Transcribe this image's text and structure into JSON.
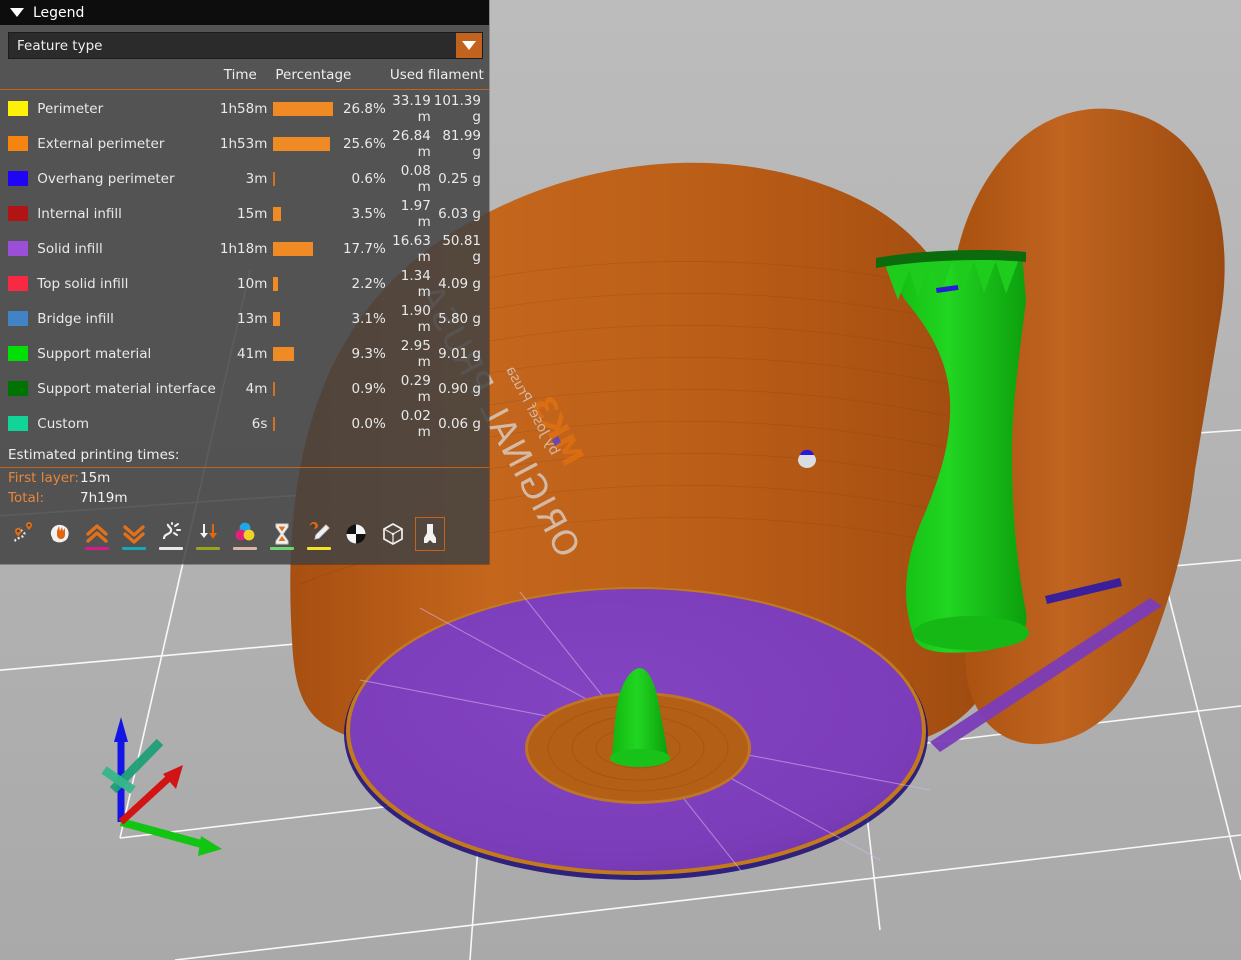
{
  "window": {
    "background_color": "#b4b4b4",
    "viewport_name": "gcode-preview-3d-viewport"
  },
  "legend": {
    "title": "Legend",
    "collapse_icon": "triangle-down-icon",
    "view_type": {
      "selected": "Feature type",
      "dropdown_icon": "chevron-down-icon"
    },
    "columns": {
      "feature": "",
      "time": "Time",
      "percentage": "Percentage",
      "used_filament": "Used filament"
    },
    "rows": [
      {
        "color": "#fcf107",
        "name": "Perimeter",
        "time": "1h58m",
        "percentage": "26.8%",
        "pct_value": 26.8,
        "length": "33.19 m",
        "weight": "101.39 g"
      },
      {
        "color": "#f58410",
        "name": "External perimeter",
        "time": "1h53m",
        "percentage": "25.6%",
        "pct_value": 25.6,
        "length": "26.84 m",
        "weight": "81.99 g"
      },
      {
        "color": "#1f04f5",
        "name": "Overhang perimeter",
        "time": "3m",
        "percentage": "0.6%",
        "pct_value": 0.6,
        "length": "0.08 m",
        "weight": "0.25 g"
      },
      {
        "color": "#b01414",
        "name": "Internal infill",
        "time": "15m",
        "percentage": "3.5%",
        "pct_value": 3.5,
        "length": "1.97 m",
        "weight": "6.03 g"
      },
      {
        "color": "#9b4fd6",
        "name": "Solid infill",
        "time": "1h18m",
        "percentage": "17.7%",
        "pct_value": 17.7,
        "length": "16.63 m",
        "weight": "50.81 g"
      },
      {
        "color": "#f82943",
        "name": "Top solid infill",
        "time": "10m",
        "percentage": "2.2%",
        "pct_value": 2.2,
        "length": "1.34 m",
        "weight": "4.09 g"
      },
      {
        "color": "#4084c6",
        "name": "Bridge infill",
        "time": "13m",
        "percentage": "3.1%",
        "pct_value": 3.1,
        "length": "1.90 m",
        "weight": "5.80 g"
      },
      {
        "color": "#00e006",
        "name": "Support material",
        "time": "41m",
        "percentage": "9.3%",
        "pct_value": 9.3,
        "length": "2.95 m",
        "weight": "9.01 g"
      },
      {
        "color": "#007400",
        "name": "Support material interface",
        "time": "4m",
        "percentage": "0.9%",
        "pct_value": 0.9,
        "length": "0.29 m",
        "weight": "0.90 g"
      },
      {
        "color": "#12d498",
        "name": "Custom",
        "time": "6s",
        "percentage": "0.0%",
        "pct_value": 0.0,
        "length": "0.02 m",
        "weight": "0.06 g"
      }
    ],
    "estimated_times": {
      "heading": "Estimated printing times:",
      "entries": [
        {
          "label": "First layer:",
          "value": "15m"
        },
        {
          "label": "Total:",
          "value": "7h19m"
        }
      ]
    },
    "toolbar": [
      {
        "name": "travel-paths-icon",
        "tooltip": "Travel",
        "underline": null,
        "active": false
      },
      {
        "name": "retractions-icon",
        "tooltip": "Retractions",
        "underline": null,
        "active": false
      },
      {
        "name": "deretractions-icon",
        "tooltip": "Deretractions",
        "underline": "#d61a8c",
        "active": false
      },
      {
        "name": "seams-icon",
        "tooltip": "Seams",
        "underline": "#18a7b5",
        "active": false
      },
      {
        "name": "wipe-icon",
        "tooltip": "Wipe",
        "underline": "#e8e8e8",
        "active": false
      },
      {
        "name": "tool-changes-icon",
        "tooltip": "Tool changes",
        "underline": "#9aa31c",
        "active": false
      },
      {
        "name": "color-changes-icon",
        "tooltip": "Color changes",
        "underline": "#d9b6a6",
        "active": false
      },
      {
        "name": "pause-prints-icon",
        "tooltip": "Pause prints",
        "underline": "#6fd66f",
        "active": false
      },
      {
        "name": "custom-gcodes-icon",
        "tooltip": "Custom G-codes",
        "underline": "#f5e22a",
        "active": false
      },
      {
        "name": "shells-icon",
        "tooltip": "Shells",
        "underline": null,
        "active": false
      },
      {
        "name": "legend-toolbar-icon",
        "tooltip": "Legend/Estimated printing time",
        "underline": null,
        "active": false
      },
      {
        "name": "tool-marker-icon",
        "tooltip": "Tool marker",
        "underline": null,
        "active": true
      }
    ]
  },
  "scene": {
    "bed_logo_primary": "ORIGINAL PRUSA",
    "bed_logo_secondary": "MK3",
    "bed_logo_tagline": "by Josef Prusa",
    "axis_gizmo": {
      "name": "axes-gizmo",
      "axes": [
        {
          "label": "X",
          "color": "#00cc00"
        },
        {
          "label": "Y",
          "color": "#cc0000"
        },
        {
          "label": "Z",
          "color": "#0000cc"
        }
      ]
    },
    "objects": [
      {
        "name": "printed-object-vase",
        "color": "#c1611a"
      },
      {
        "name": "tree-support-structure",
        "color": "#1ec81e"
      },
      {
        "name": "solid-infill-disc",
        "color": "#7f3fbf"
      }
    ]
  }
}
